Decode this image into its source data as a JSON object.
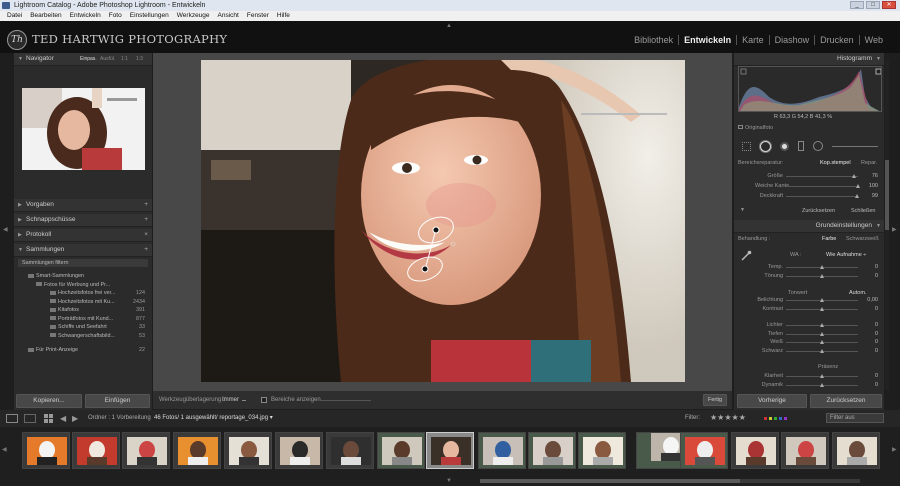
{
  "window": {
    "title": "Lightroom Catalog - Adobe Photoshop Lightroom - Entwickeln",
    "controls": [
      "_",
      "□",
      "✕"
    ]
  },
  "menu": [
    "Datei",
    "Bearbeiten",
    "Entwickeln",
    "Foto",
    "Einstellungen",
    "Werkzeuge",
    "Ansicht",
    "Fenster",
    "Hilfe"
  ],
  "identity": {
    "logo_text": "Th",
    "studio_name": "TED HARTWIG PHOTOGRAPHY"
  },
  "modules": [
    {
      "label": "Bibliothek",
      "active": false
    },
    {
      "label": "Entwickeln",
      "active": true
    },
    {
      "label": "Karte",
      "active": false
    },
    {
      "label": "Diashow",
      "active": false
    },
    {
      "label": "Drucken",
      "active": false
    },
    {
      "label": "Web",
      "active": false
    }
  ],
  "left": {
    "navigator": {
      "title": "Navigator",
      "zoom_options": [
        "Einpas.",
        "Ausfül.",
        "1:1",
        "1:3"
      ]
    },
    "sections": [
      {
        "label": "Vorgaben",
        "action": "+"
      },
      {
        "label": "Schnappschüsse",
        "action": "+"
      },
      {
        "label": "Protokoll",
        "action": "×"
      },
      {
        "label": "Sammlungen",
        "action": "+"
      }
    ],
    "collections": [
      {
        "label": "Sammlungen filtern",
        "count": ""
      },
      {
        "label": "Smart-Sammlungen",
        "count": ""
      },
      {
        "label": "Fotos für Werbung und Pr...",
        "count": ""
      },
      {
        "label": "Hochzeitsfotos frei ver...",
        "count": "124"
      },
      {
        "label": "Hochzeitsfotos mit Ku...",
        "count": "2434"
      },
      {
        "label": "Kitafotos",
        "count": "391"
      },
      {
        "label": "Porträtfotos mit Kund...",
        "count": "877"
      },
      {
        "label": "Schiffe und Seefahrt",
        "count": "33"
      },
      {
        "label": "Schwangerschaftsbild...",
        "count": "53"
      },
      {
        "label": "Für Print-Anzeige",
        "count": "22"
      }
    ],
    "buttons": {
      "copy": "Kopieren...",
      "paste": "Einfügen"
    }
  },
  "toolbar": {
    "overlay_label": "Werkzeugüberlagerung :",
    "overlay_value": "Immer",
    "show_areas": "Bereiche anzeigen",
    "done": "Fertig"
  },
  "right": {
    "histogram": {
      "title": "Histogramm",
      "readout": "R  63,3  G  54,2  B  41,3  %",
      "original_label": "Originalfoto"
    },
    "spot_removal": {
      "label": "Bereichsreparatur:",
      "modes": [
        "Kop.stempel",
        "Repar."
      ],
      "sliders": [
        {
          "label": "Größe",
          "value": "76",
          "pos": 0.95
        },
        {
          "label": "Weiche Kante",
          "value": "100",
          "pos": 1.0
        },
        {
          "label": "Deckkraft",
          "value": "99",
          "pos": 0.99
        }
      ],
      "reset": "Zurücksetzen",
      "close": "Schließen"
    },
    "basic": {
      "title": "Grundeinstellungen",
      "treatment_label": "Behandlung :",
      "treatment_options": [
        "Farbe",
        "Schwarzweiß"
      ],
      "wb_label": "WA :",
      "wb_value": "Wie Aufnahme ÷",
      "tone_label": "Tonwert",
      "auto": "Autom.",
      "presence_label": "Präsenz",
      "sliders": [
        {
          "label": "Temp.",
          "value": "0",
          "pos": 0.5
        },
        {
          "label": "Tönung",
          "value": "0",
          "pos": 0.5
        },
        {
          "label": "Belichtung",
          "value": "0,00",
          "pos": 0.5
        },
        {
          "label": "Kontrast",
          "value": "0",
          "pos": 0.5
        },
        {
          "label": "Lichter",
          "value": "0",
          "pos": 0.5
        },
        {
          "label": "Tiefen",
          "value": "0",
          "pos": 0.5
        },
        {
          "label": "Weiß",
          "value": "0",
          "pos": 0.5
        },
        {
          "label": "Schwarz",
          "value": "0",
          "pos": 0.5
        },
        {
          "label": "Klarheit",
          "value": "0",
          "pos": 0.5
        },
        {
          "label": "Dynamik",
          "value": "0",
          "pos": 0.5
        }
      ]
    },
    "buttons": {
      "previous": "Vorherige",
      "reset": "Zurücksetzen"
    }
  },
  "filmstrip": {
    "path": "Ordner : 1 Vorbereitung",
    "count": "46 Fotos/ 1 ausgewählt/ reportage_034.jpg ▾",
    "filter_label": "Filter:",
    "stars": "★★★★★",
    "filter_value": "Filter aus"
  }
}
